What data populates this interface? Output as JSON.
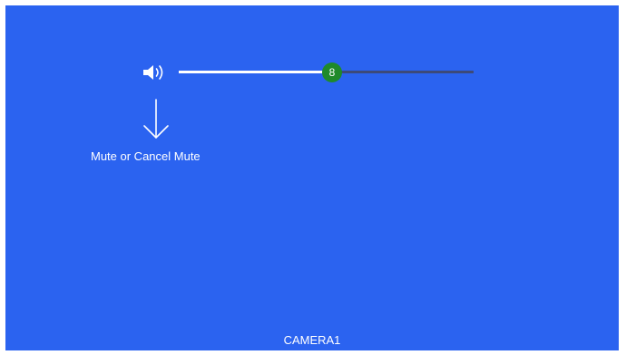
{
  "volume": {
    "icon": "speaker-volume-icon",
    "value": "8",
    "level_percent": 52
  },
  "hint": {
    "icon": "arrow-down-icon",
    "text": "Mute or Cancel Mute"
  },
  "camera": {
    "label": "CAMERA1"
  },
  "colors": {
    "background": "#2b63f0",
    "thumb": "#1f8a2a",
    "track_filled": "#ffffff",
    "track_empty": "#3d4a7a",
    "text": "#ffffff"
  }
}
